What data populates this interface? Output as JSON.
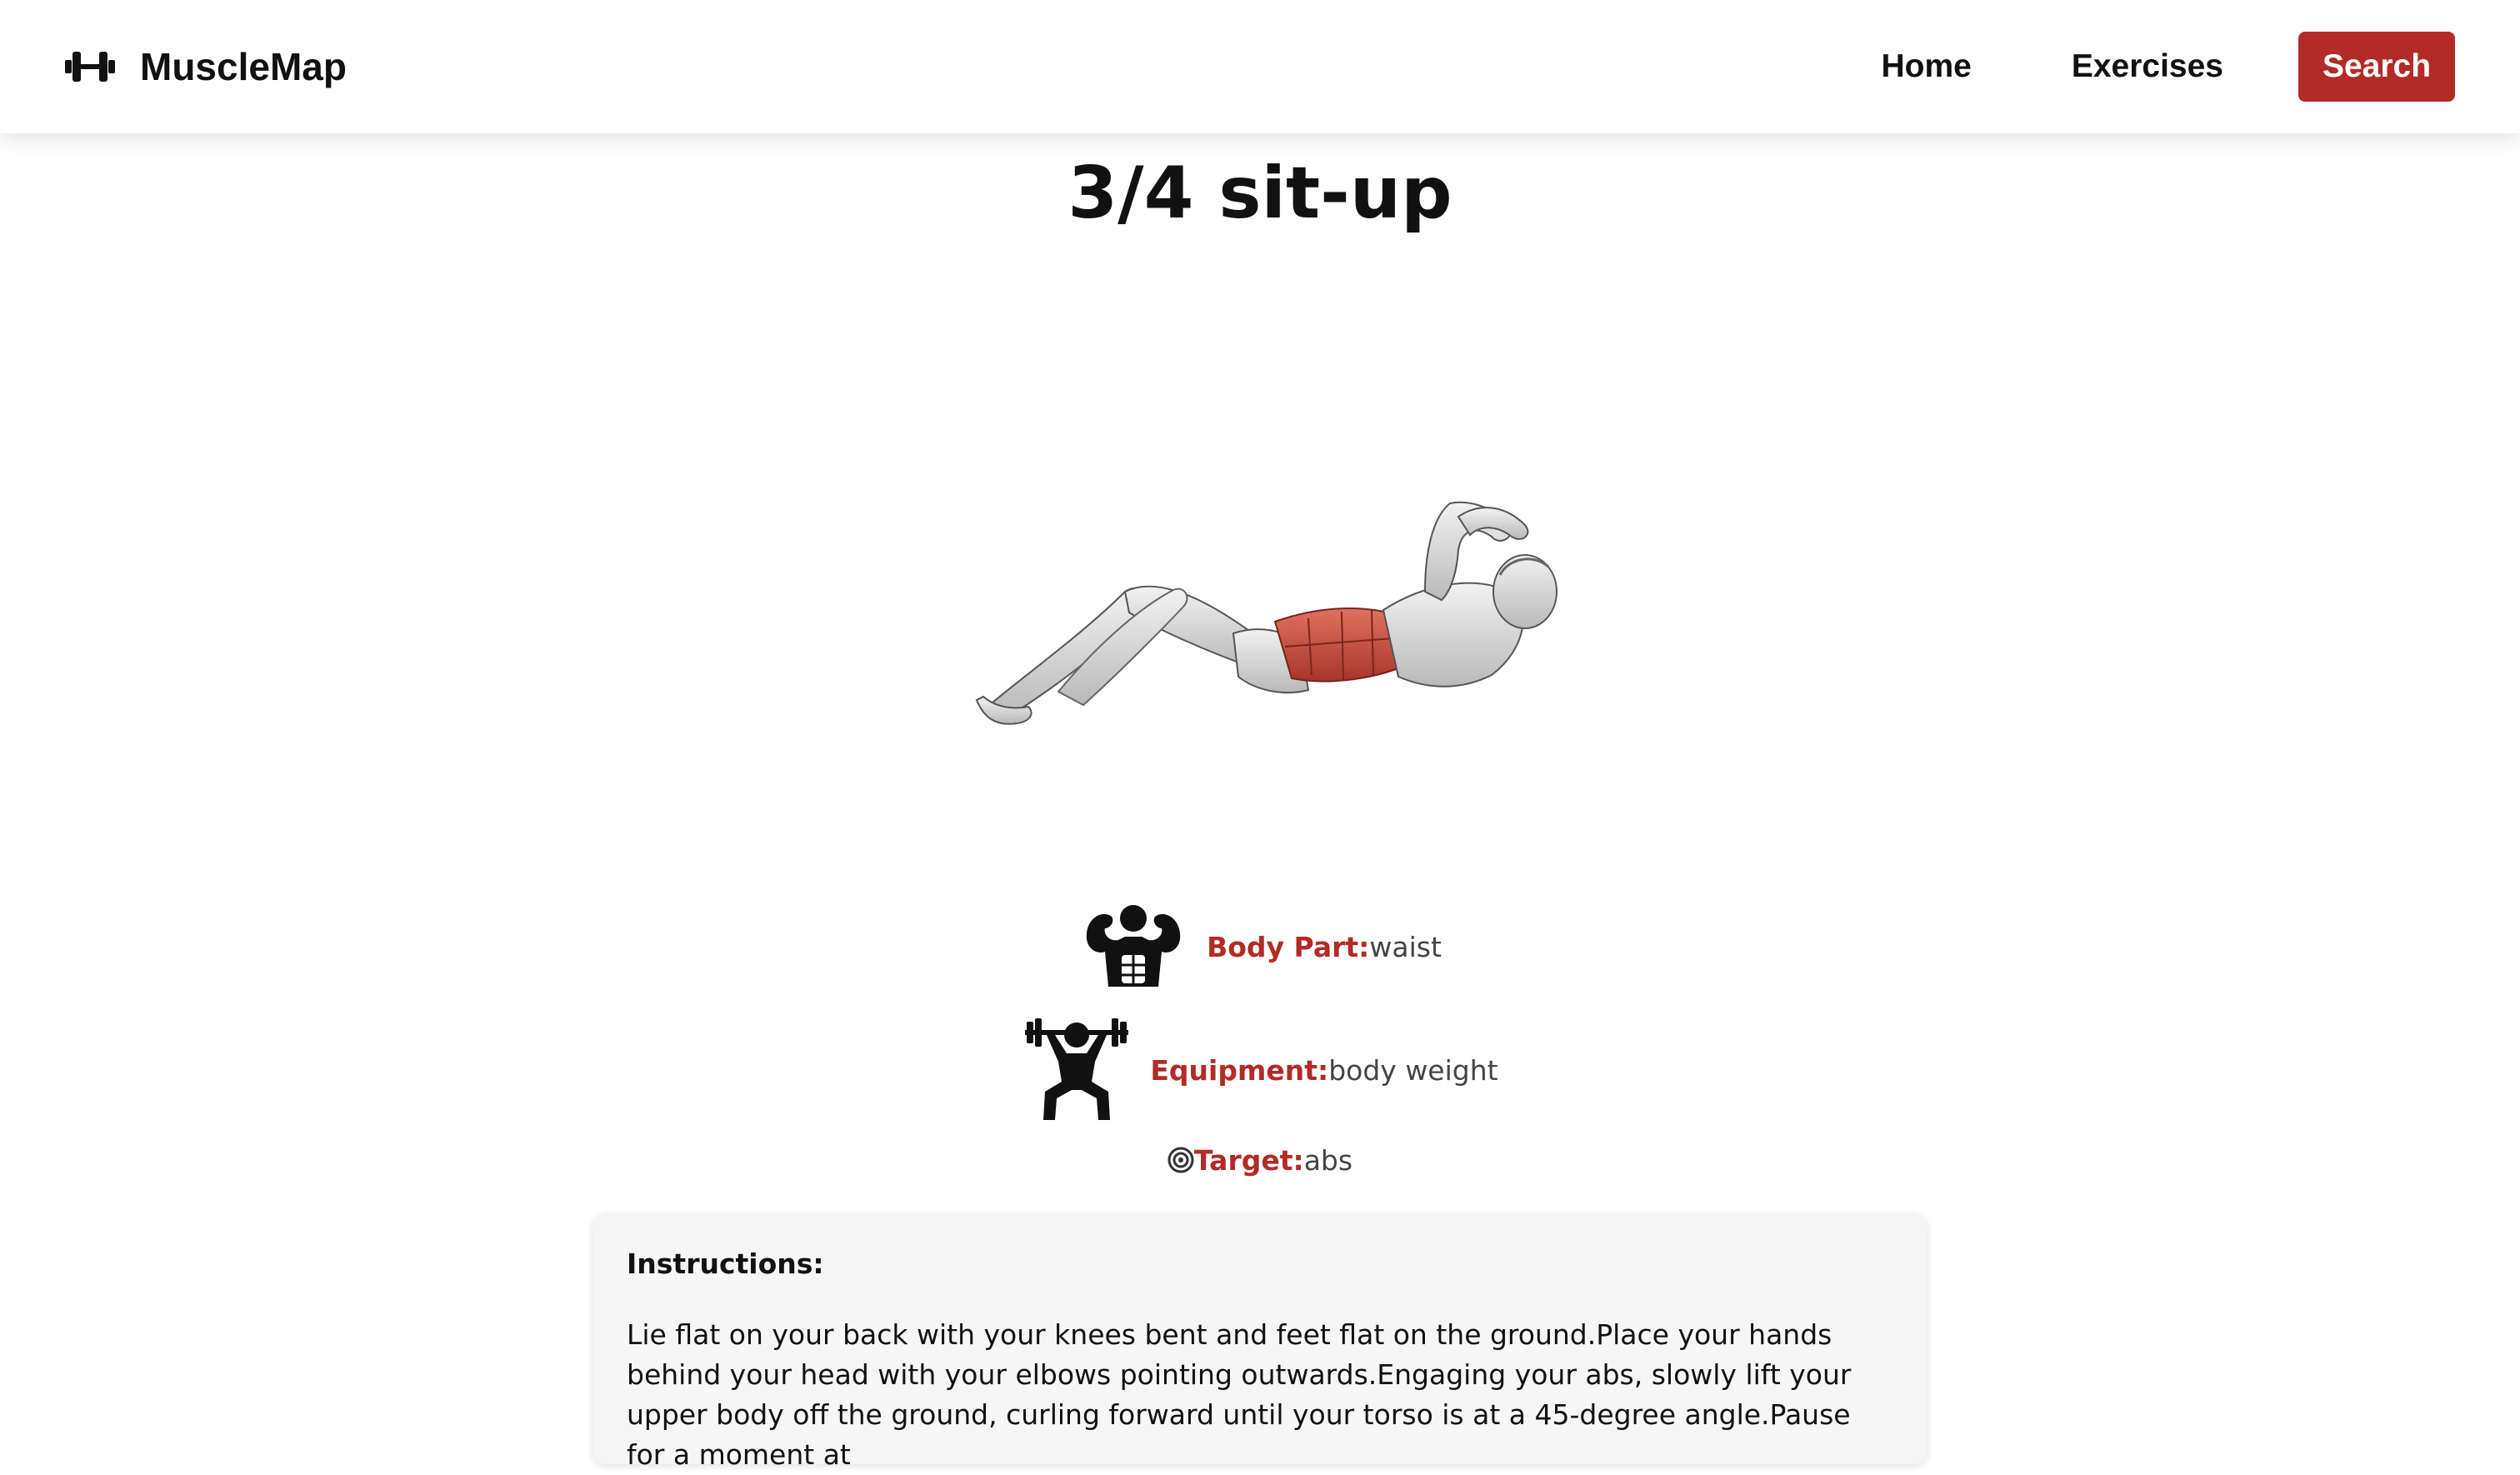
{
  "brand": {
    "name": "MuscleMap",
    "icon": "dumbbell-icon"
  },
  "nav": {
    "home_label": "Home",
    "exercises_label": "Exercises",
    "search_label": "Search"
  },
  "colors": {
    "accent": "#b32a26",
    "navbar_bg": "#ffffff",
    "panel_bg": "#f6f6f6"
  },
  "exercise": {
    "title": "3/4 sit-up",
    "image_icon": "sit-up-illustration",
    "body_part": {
      "label": "Body Part:",
      "value": "waist",
      "icon": "muscular-body-icon"
    },
    "equipment": {
      "label": "Equipment:",
      "value": "body weight",
      "icon": "weightlifter-icon"
    },
    "target": {
      "label": "Target:",
      "value": "abs",
      "icon": "target-icon",
      "glyph": "◎"
    },
    "instructions_title": "Instructions:",
    "instructions": "Lie flat on your back with your knees bent and feet flat on the ground.Place your hands behind your head with your elbows pointing outwards.Engaging your abs, slowly lift your upper body off the ground, curling forward until your torso is at a 45-degree angle.Pause for a moment at"
  }
}
